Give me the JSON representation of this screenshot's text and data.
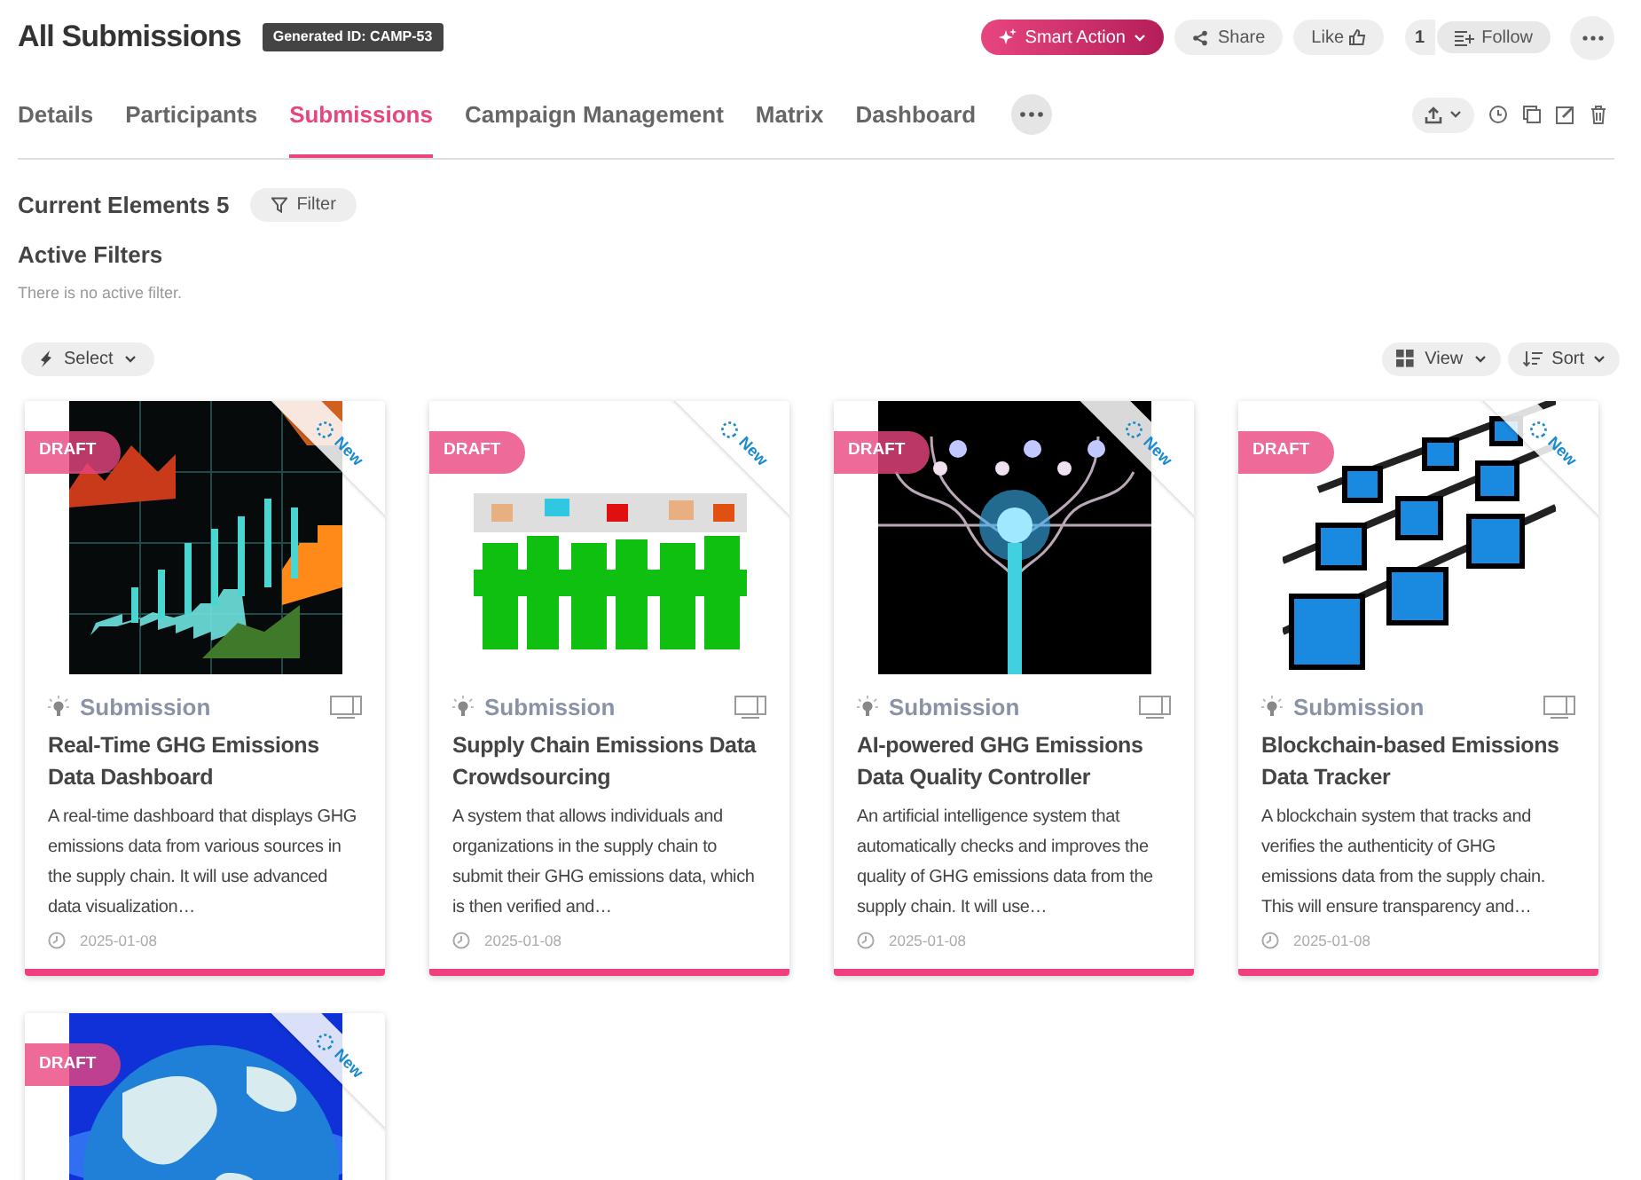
{
  "header": {
    "title": "All Submissions",
    "id_badge": "Generated ID: CAMP-53",
    "actions": [
      {
        "kind": "primary",
        "label": "Smart Action"
      },
      {
        "kind": "share",
        "label": "Share"
      },
      {
        "kind": "like",
        "label": "Like"
      },
      {
        "kind": "count",
        "label": "1"
      },
      {
        "kind": "follow",
        "label": "Follow"
      },
      {
        "kind": "more"
      }
    ]
  },
  "tabs": [
    {
      "label": "Details",
      "selected": false
    },
    {
      "label": "Participants",
      "selected": false
    },
    {
      "label": "Submissions",
      "selected": true
    },
    {
      "label": "Campaign Management",
      "selected": false
    },
    {
      "label": "Matrix",
      "selected": false
    },
    {
      "label": "Dashboard",
      "selected": false
    }
  ],
  "summary": {
    "count_label": "Current Elements 5",
    "filter_button": "Filter",
    "filters_heading": "Active Filters",
    "filters_empty": "There is no active filter."
  },
  "toolbar": {
    "select": "Select",
    "view": "View",
    "sort": "Sort"
  },
  "cards": [
    {
      "status": "DRAFT",
      "ribbon": "New",
      "type": "Submission",
      "title": "Real-Time GHG Emissions Data Dashboard",
      "description": "A real-time dashboard that displays GHG emissions data from various sources in the supply chain. It will use advanced data visualization…",
      "date": "2025-01-08"
    },
    {
      "status": "DRAFT",
      "ribbon": "New",
      "type": "Submission",
      "title": "Supply Chain Emissions Data Crowdsourcing",
      "description": "A system that allows individuals and organizations in the supply chain to submit their GHG emissions data, which is then verified and…",
      "date": "2025-01-08"
    },
    {
      "status": "DRAFT",
      "ribbon": "New",
      "type": "Submission",
      "title": "AI-powered GHG Emissions Data Quality Controller",
      "description": "An artificial intelligence system that automatically checks and improves the quality of GHG emissions data from the supply chain. It will use…",
      "date": "2025-01-08"
    },
    {
      "status": "DRAFT",
      "ribbon": "New",
      "type": "Submission",
      "title": "Blockchain-based Emissions Data Tracker",
      "description": "A blockchain system that tracks and verifies the authenticity of GHG emissions data from the supply chain. This will ensure transparency and…",
      "date": "2025-01-08"
    },
    {
      "status": "DRAFT",
      "ribbon": "New"
    }
  ]
}
